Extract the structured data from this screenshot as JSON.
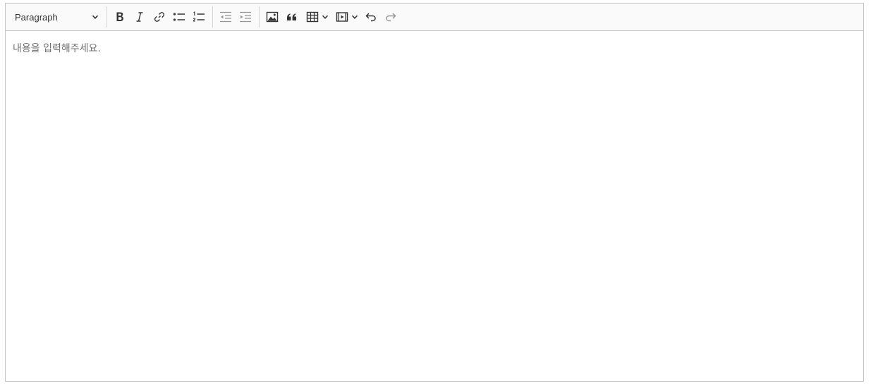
{
  "toolbar": {
    "heading": {
      "selected": "Paragraph",
      "icon": "chevron-down-icon"
    },
    "buttons": [
      {
        "id": "bold",
        "icon": "bold-icon"
      },
      {
        "id": "italic",
        "icon": "italic-icon"
      },
      {
        "id": "link",
        "icon": "link-icon"
      },
      {
        "id": "bulleted-list",
        "icon": "bulleted-list-icon"
      },
      {
        "id": "numbered-list",
        "icon": "numbered-list-icon"
      },
      {
        "id": "outdent",
        "icon": "outdent-icon",
        "disabled": true
      },
      {
        "id": "indent",
        "icon": "indent-icon",
        "disabled": true
      },
      {
        "id": "insert-image",
        "icon": "image-icon"
      },
      {
        "id": "block-quote",
        "icon": "quote-icon"
      },
      {
        "id": "insert-table",
        "icon": "table-icon"
      },
      {
        "id": "insert-media",
        "icon": "media-icon"
      },
      {
        "id": "undo",
        "icon": "undo-icon"
      },
      {
        "id": "redo",
        "icon": "redo-icon",
        "disabled": true
      }
    ]
  },
  "editor": {
    "placeholder": "내용을 입력해주세요."
  },
  "colors": {
    "icon": "#333333",
    "border": "#c4c4c4",
    "toolbar_bg": "#fafafa",
    "placeholder": "#707070"
  }
}
